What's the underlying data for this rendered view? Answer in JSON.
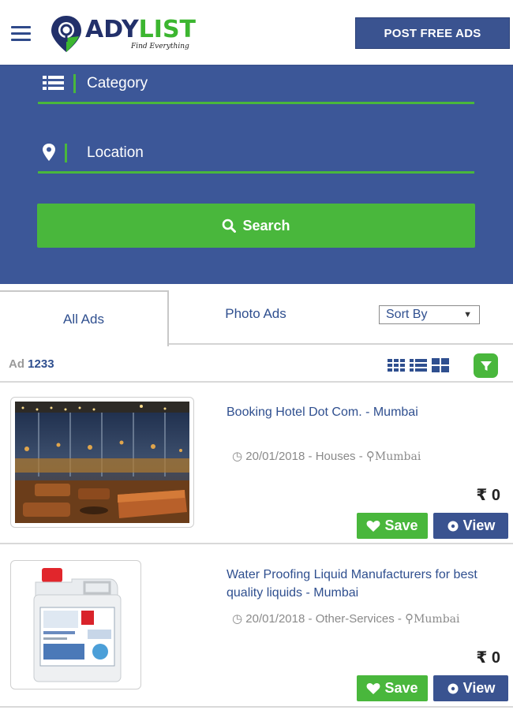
{
  "header": {
    "logo_text_a": "ADY",
    "logo_text_b": "LIST",
    "logo_tagline": "Find Everything",
    "post_button": "POST FREE ADS"
  },
  "search": {
    "category_label": "Category",
    "location_label": "Location",
    "search_button": "Search"
  },
  "tabs": {
    "all_ads": "All Ads",
    "photo_ads": "Photo Ads",
    "sort_by": "Sort By"
  },
  "toolbar": {
    "ad_prefix": "Ad",
    "ad_count": "1233"
  },
  "ads": [
    {
      "title": "Booking Hotel Dot Com. - Mumbai",
      "date": "20/01/2018",
      "category": "Houses",
      "city": "Mumbai",
      "price": "₹ 0",
      "save_label": "Save",
      "view_label": "View"
    },
    {
      "title": "Water Proofing Liquid Manufacturers for best quality liquids - Mumbai",
      "date": "20/01/2018",
      "category": "Other-Services",
      "city": "Mumbai",
      "price": "₹ 0",
      "save_label": "Save",
      "view_label": "View"
    }
  ],
  "colors": {
    "brand_blue": "#3c5798",
    "brand_green": "#49b73c",
    "link_blue": "#2f4f8f"
  }
}
